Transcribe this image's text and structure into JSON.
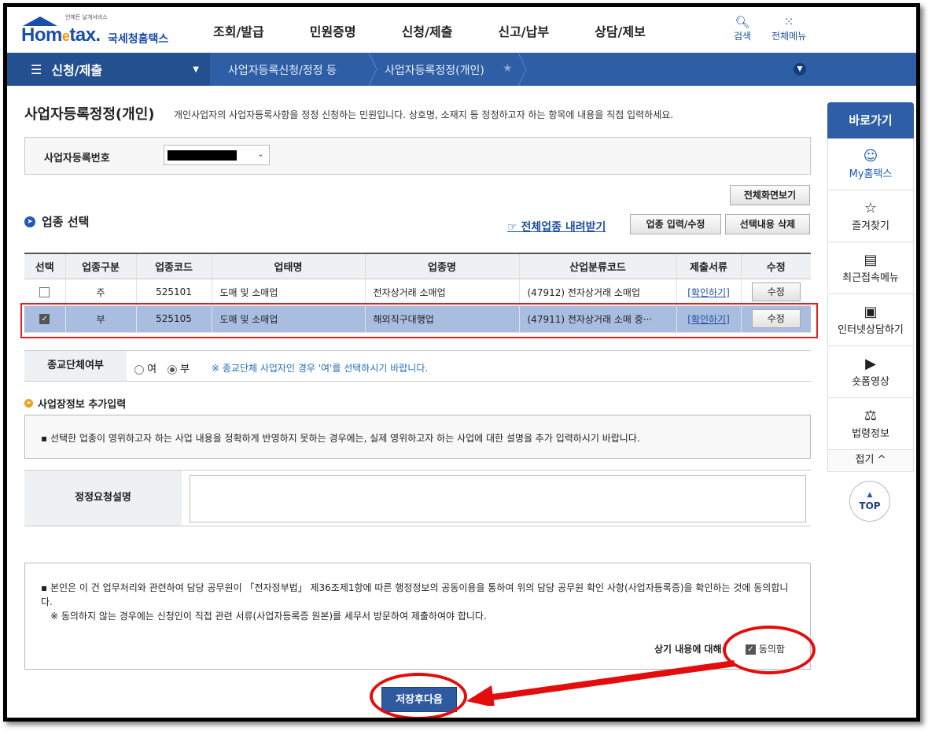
{
  "header": {
    "logo_sub": "언제든 날개서비스",
    "logo_main_a": "Hom",
    "logo_main_e": "e",
    "logo_main_b": "tax.",
    "logo_kr": "국세청홈택스",
    "gnb": [
      "조회/발급",
      "민원증명",
      "신청/제출",
      "신고/납부",
      "상담/제보"
    ],
    "search_label": "검색",
    "allmenu_label": "전체메뉴"
  },
  "navbar": {
    "menu_label": "신청/제출",
    "crumb1": "사업자등록신청/정정 등",
    "crumb2": "사업자등록정정(개인)"
  },
  "main": {
    "title": "사업자등록정정(개인)",
    "description": "개인사업자의 사업자등록사항을 정정 신청하는 민원입니다. 상호명, 소재지 등 정정하고자 하는 항목에 내용을 직접 입력하세요.",
    "reg_no_label": "사업자등록번호",
    "btn_fullscreen": "전체화면보기",
    "section_title": "업종 선택",
    "download_link": "전체업종 내려받기",
    "btn_industry_input": "업종 입력/수정",
    "btn_delete_selected": "선택내용 삭제"
  },
  "table": {
    "headers": [
      "선택",
      "업종구분",
      "업종코드",
      "업태명",
      "업종명",
      "산업분류코드",
      "제출서류",
      "수정"
    ],
    "rows": [
      {
        "checked": false,
        "type": "주",
        "code": "525101",
        "business": "도매 및 소매업",
        "industry": "전자상거래 소매업",
        "class_code": "(47912) 전자상거래 소매업",
        "docs": "[확인하기]",
        "edit": "수정"
      },
      {
        "checked": true,
        "type": "부",
        "code": "525105",
        "business": "도매 및 소매업",
        "industry": "해외직구대행업",
        "class_code": "(47911) 전자상거래 소매 중···",
        "docs": "[확인하기]",
        "edit": "수정"
      }
    ]
  },
  "religious": {
    "label": "종교단체여부",
    "opt_yes": "여",
    "opt_no": "부",
    "note": "※ 종교단체 사업자인 경우 '여'를 선택하시기 바랍니다."
  },
  "extra": {
    "title": "사업장정보 추가입력",
    "info": "▪ 선택한 업종이 영위하고자 하는 사업 내용을 정확하게 반영하지 못하는 경우에는, 실제 영위하고자 하는 사업에 대한 설명을 추가 입력하시기 바랍니다.",
    "desc_label": "정정요청설명"
  },
  "agree": {
    "text1": "▪ 본인은 이 건 업무처리와 관련하여 담당 공무원이 「전자정부법」 제36조제1항에 따른 행정정보의 공동이용을 통하여 위의 담당 공무원 확인 사항(사업자등록증)을 확인하는 것에 동의합니다.",
    "text2": "※ 동의하지 않는 경우에는 신청인이 직접 관련 서류(사업자등록증 원본)를 세무서 방문하여 제출하여야 합니다.",
    "question": "상기 내용에 대해",
    "agree_label": "동의함"
  },
  "save_button": "저장후다음",
  "rail": {
    "head": "바로가기",
    "items": [
      "My홈택스",
      "즐겨찾기",
      "최근접속메뉴",
      "인터넷상담하기",
      "숏폼영상",
      "법령정보"
    ],
    "fold": "접기 ^",
    "top": "TOP"
  },
  "colors": {
    "brand_blue": "#2e5fa6",
    "highlight_row": "#a8bde0",
    "annotation_red": "#e30d0d"
  }
}
